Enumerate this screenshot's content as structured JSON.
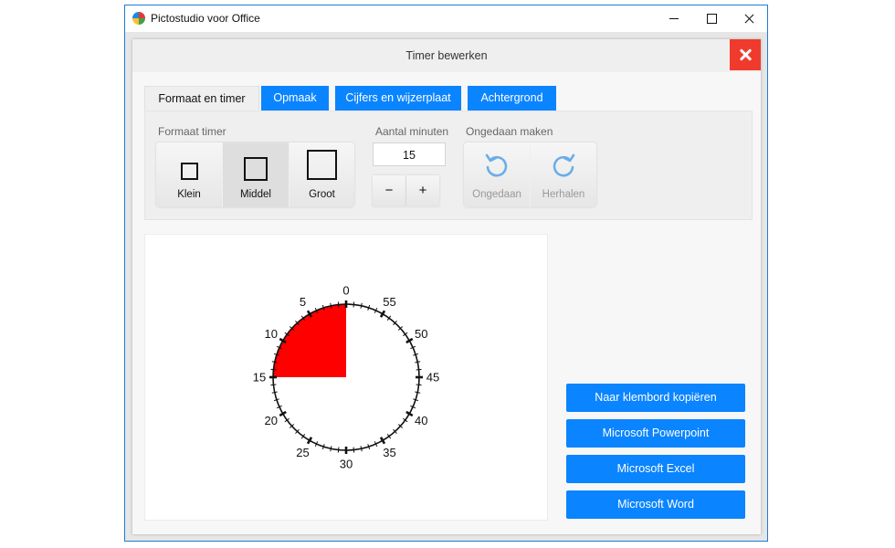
{
  "window": {
    "title": "Pictostudio voor Office"
  },
  "dialog": {
    "title": "Timer bewerken"
  },
  "tabs": [
    "Formaat en timer",
    "Opmaak",
    "Cijfers en wijzerplaat",
    "Achtergrond"
  ],
  "format": {
    "label": "Formaat timer",
    "options": [
      "Klein",
      "Middel",
      "Groot"
    ],
    "selected": "Middel"
  },
  "minutes": {
    "label": "Aantal minuten",
    "value": "15",
    "minus": "−",
    "plus": "+"
  },
  "undo": {
    "label": "Ongedaan maken",
    "undo_label": "Ongedaan",
    "redo_label": "Herhalen"
  },
  "timer": {
    "minutes": 15,
    "labels": [
      "0",
      "5",
      "10",
      "15",
      "20",
      "25",
      "30",
      "35",
      "40",
      "45",
      "50",
      "55"
    ],
    "fill_color": "#ff0000"
  },
  "actions": [
    "Naar klembord kopiëren",
    "Microsoft Powerpoint",
    "Microsoft Excel",
    "Microsoft Word"
  ],
  "colors": {
    "accent": "#0a84ff",
    "close": "#f03a2e",
    "icon_disabled": "#6aaee8"
  }
}
